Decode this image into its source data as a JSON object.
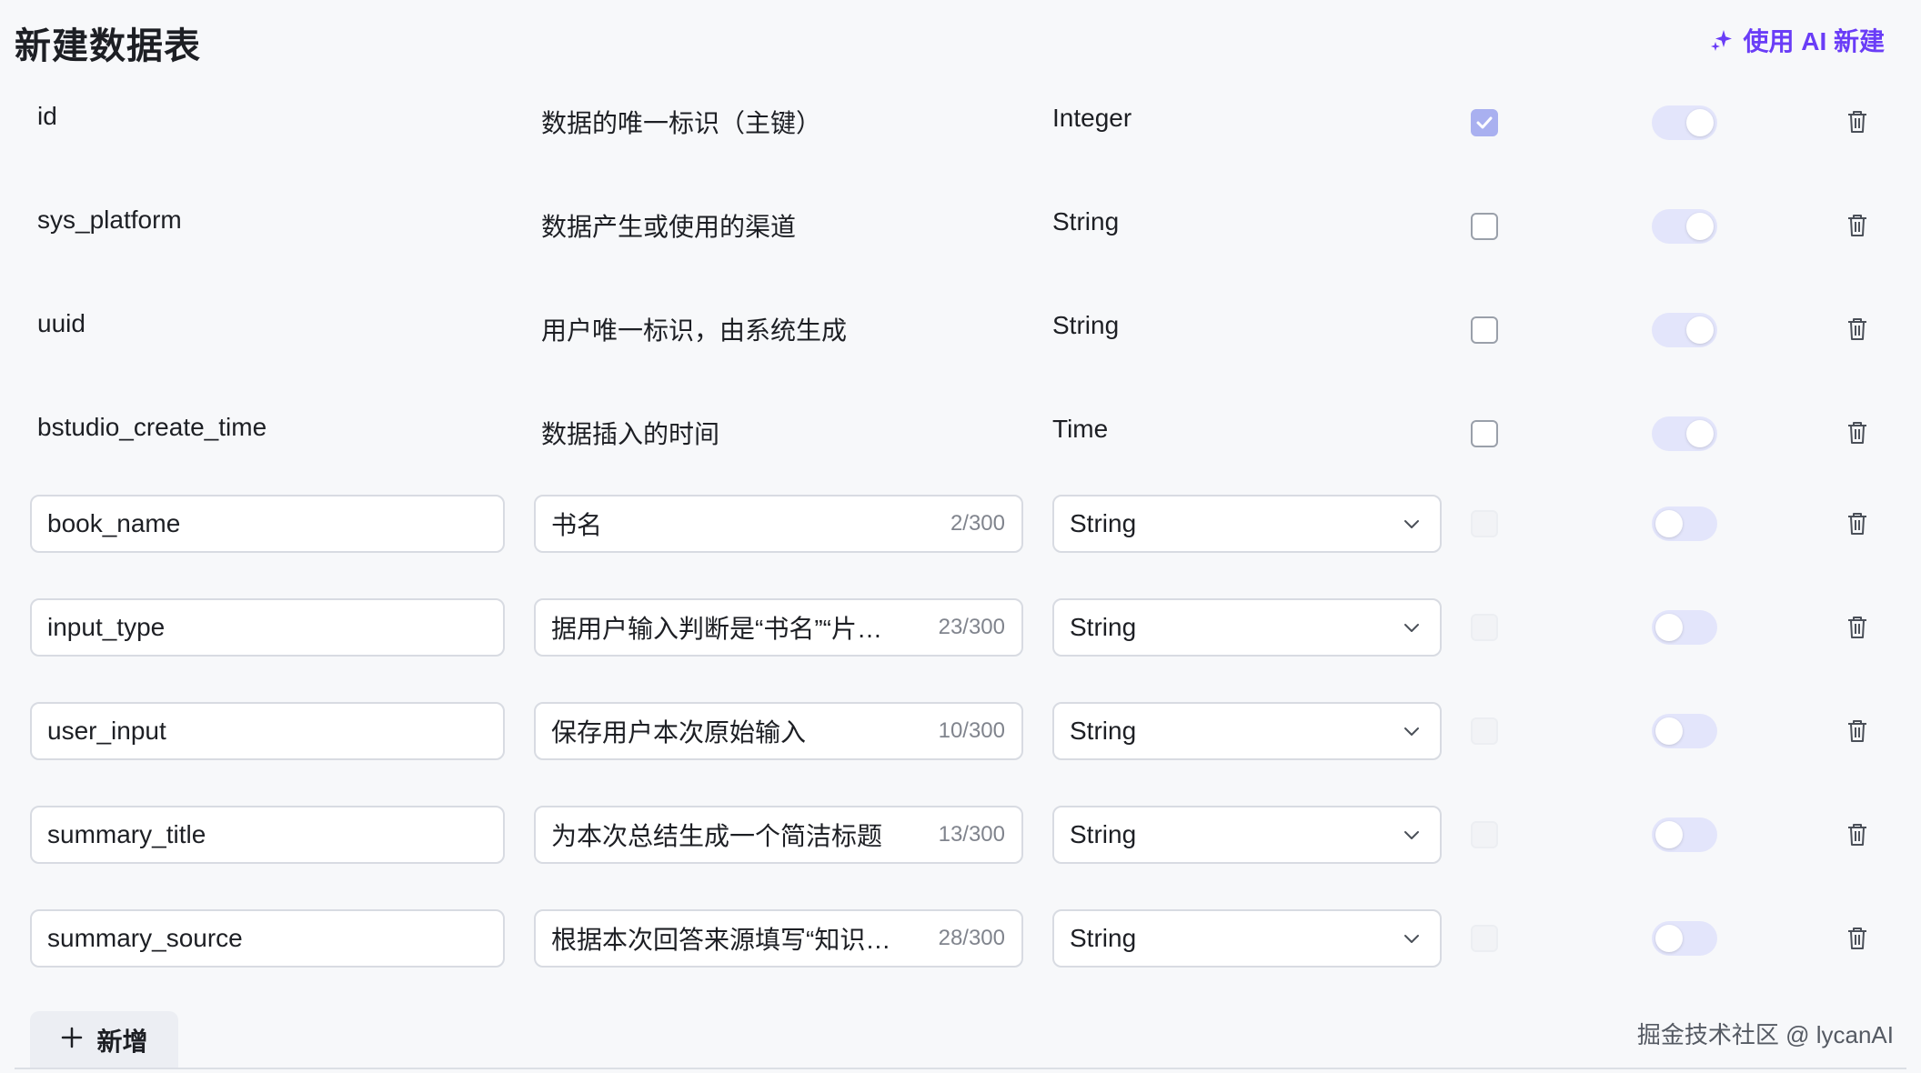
{
  "header": {
    "title": "新建数据表",
    "ai_button_label": "使用 AI 新建"
  },
  "colors": {
    "accent": "#6a3df7",
    "toggle_track": "#e3e5fb",
    "checkbox_checked": "#a9b0f0",
    "border": "#d8dbe2"
  },
  "system_fields": [
    {
      "name": "id",
      "description": "数据的唯一标识（主键）",
      "type": "Integer",
      "required_checked": true
    },
    {
      "name": "sys_platform",
      "description": "数据产生或使用的渠道",
      "type": "String",
      "required_checked": false
    },
    {
      "name": "uuid",
      "description": "用户唯一标识，由系统生成",
      "type": "String",
      "required_checked": false
    },
    {
      "name": "bstudio_create_time",
      "description": "数据插入的时间",
      "type": "Time",
      "required_checked": false
    }
  ],
  "custom_fields": [
    {
      "name": "book_name",
      "description": "书名",
      "counter": "2/300",
      "type": "String"
    },
    {
      "name": "input_type",
      "description": "据用户输入判断是“书名”“片…",
      "counter": "23/300",
      "type": "String"
    },
    {
      "name": "user_input",
      "description": "保存用户本次原始输入",
      "counter": "10/300",
      "type": "String"
    },
    {
      "name": "summary_title",
      "description": "为本次总结生成一个简洁标题",
      "counter": "13/300",
      "type": "String"
    },
    {
      "name": "summary_source",
      "description": "根据本次回答来源填写“知识…",
      "counter": "28/300",
      "type": "String"
    }
  ],
  "add_button_label": "新增",
  "watermark": "掘金技术社区 @ lycanAI"
}
